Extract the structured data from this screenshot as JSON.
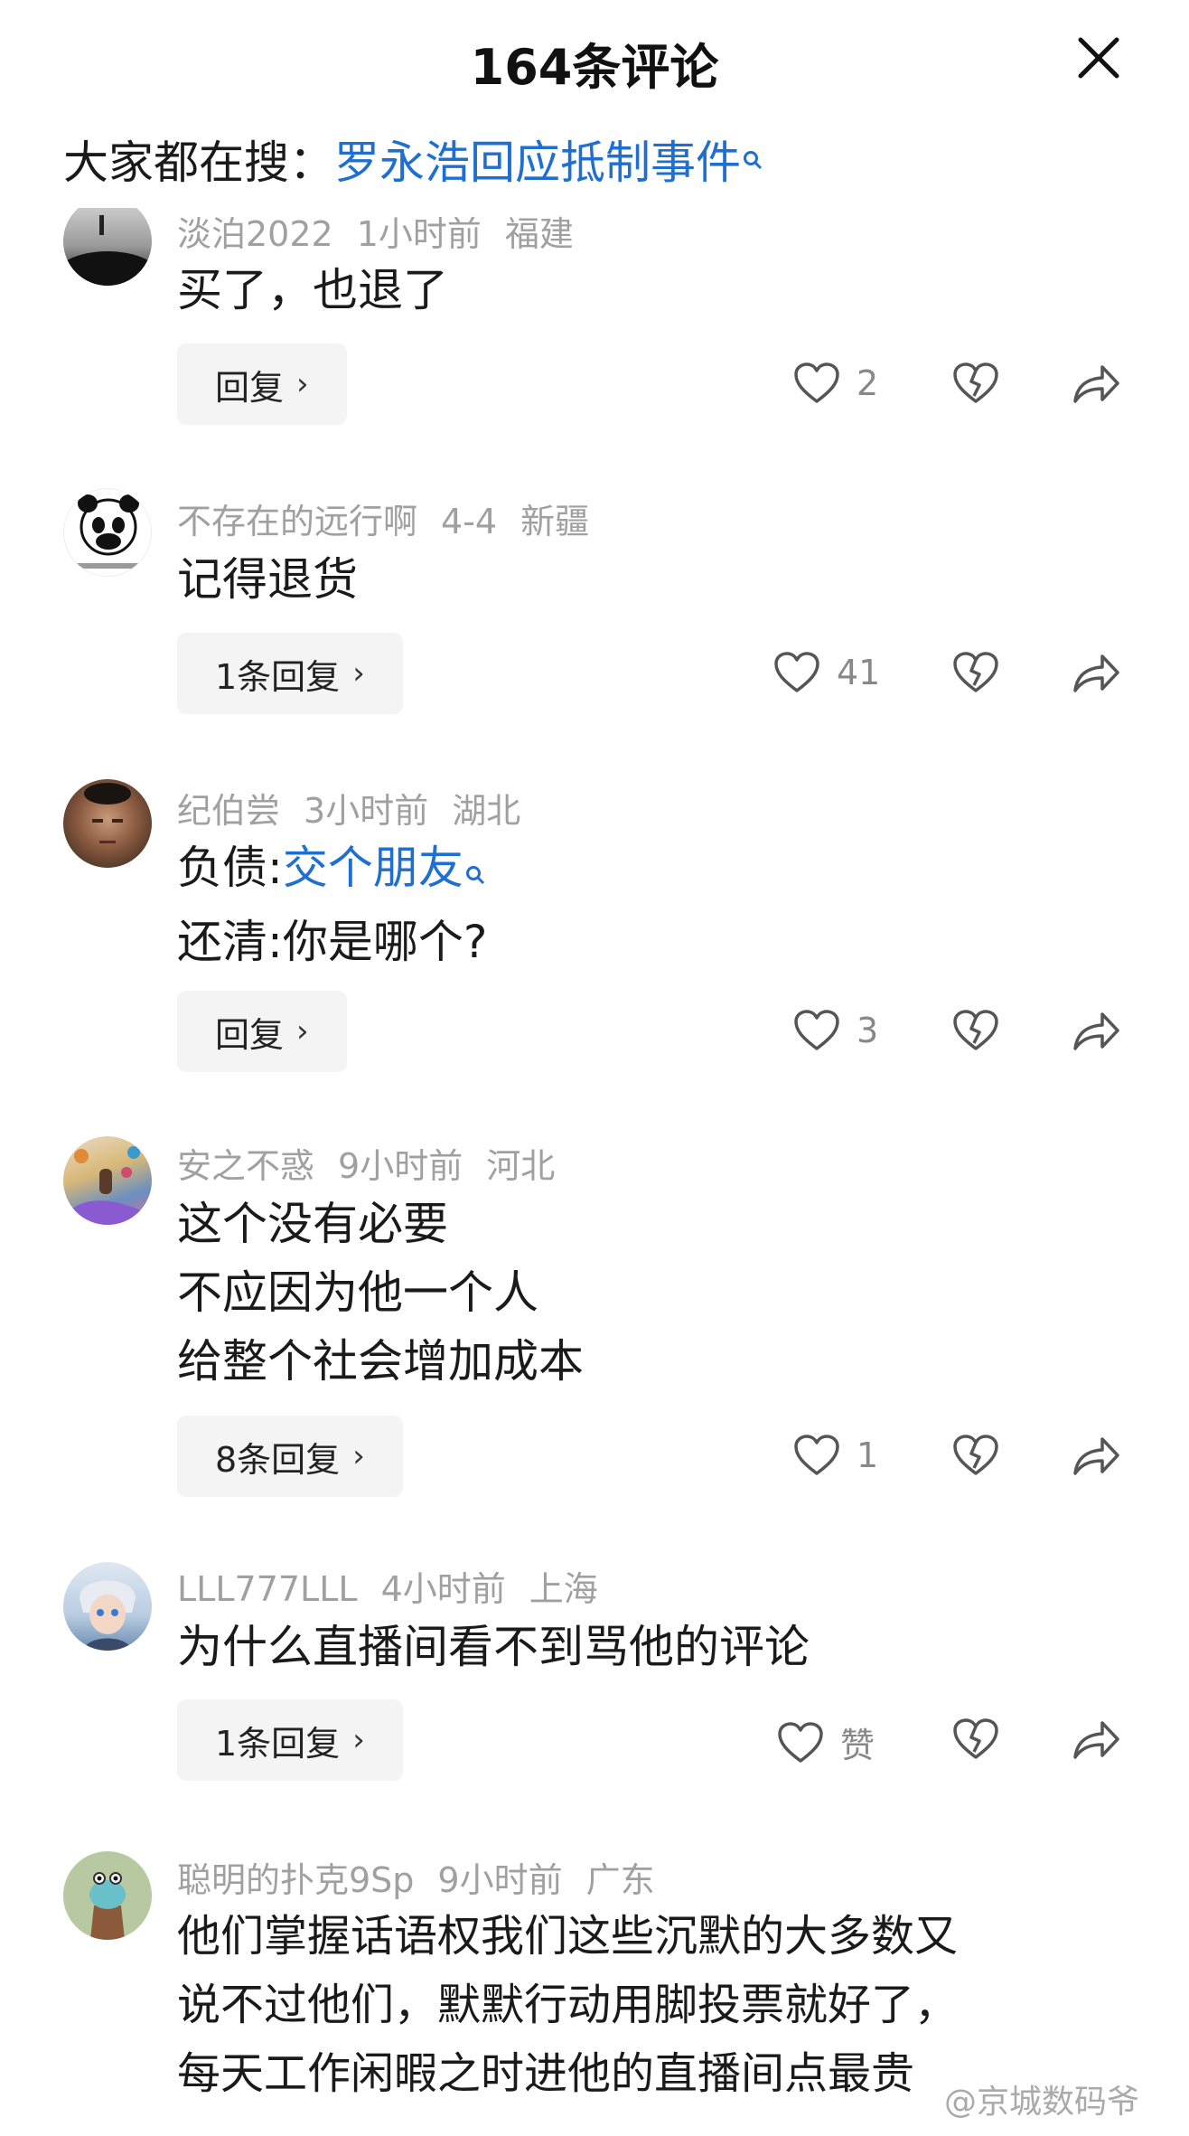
{
  "header": {
    "title": "164条评论"
  },
  "search": {
    "label": "大家都在搜：",
    "query": "罗永浩回应抵制事件"
  },
  "comments": [
    {
      "user": "淡泊2022",
      "time": "1小时前",
      "location": "福建",
      "lines": [
        "买了，也退了"
      ],
      "reply_label": "回复",
      "likes": "2"
    },
    {
      "user": "不存在的远行啊",
      "time": "4-4",
      "location": "新疆",
      "lines": [
        "记得退货"
      ],
      "reply_label": "1条回复",
      "likes": "41"
    },
    {
      "user": "纪伯尝",
      "time": "3小时前",
      "location": "湖北",
      "line1_prefix": "负债:",
      "line1_link": "交个朋友",
      "lines": [
        "还清:你是哪个?"
      ],
      "reply_label": "回复",
      "likes": "3"
    },
    {
      "user": "安之不惑",
      "time": "9小时前",
      "location": "河北",
      "lines": [
        "这个没有必要",
        "不应因为他一个人",
        "给整个社会增加成本"
      ],
      "reply_label": "8条回复",
      "likes": "1"
    },
    {
      "user": "LLL777LLL",
      "time": "4小时前",
      "location": "上海",
      "lines": [
        "为什么直播间看不到骂他的评论"
      ],
      "reply_label": "1条回复",
      "likes": "赞"
    },
    {
      "user": "聪明的扑克9Sp",
      "time": "9小时前",
      "location": "广东",
      "lines": [
        "他们掌握话语权我们这些沉默的大多数又",
        "说不过他们，默默行动用脚投票就好了，",
        "每天工作闲暇之时进他的直播间点最贵"
      ]
    }
  ],
  "watermark": "@京城数码爷",
  "colors": {
    "link": "#1e6fd0",
    "meta": "#a0a0a0",
    "button_bg": "#f4f4f4"
  },
  "icons": {
    "close": "close-icon",
    "like": "heart-icon",
    "dislike": "broken-heart-icon",
    "share": "share-arrow-icon",
    "search": "search-mini-icon"
  }
}
